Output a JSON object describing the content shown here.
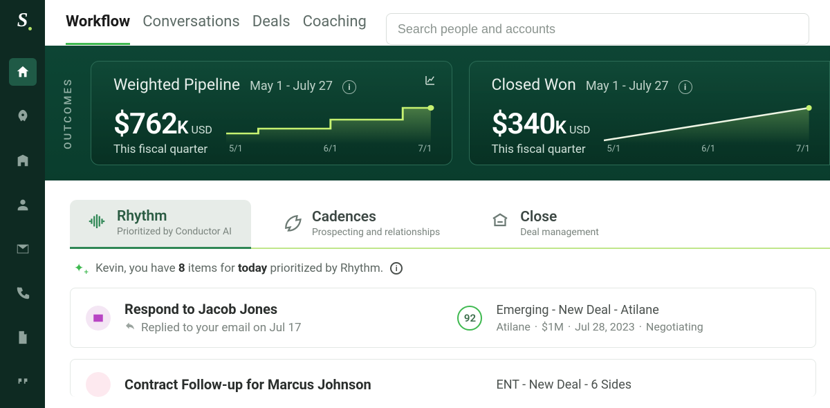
{
  "nav": {
    "items": [
      "Workflow",
      "Conversations",
      "Deals",
      "Coaching"
    ],
    "active": 0
  },
  "search": {
    "placeholder": "Search people and accounts"
  },
  "outcomes_label": "OUTCOMES",
  "cards": [
    {
      "title": "Weighted Pipeline",
      "date_range": "May 1 - July 27",
      "value": "$762",
      "unit": "K",
      "currency": "USD",
      "sub": "This fiscal quarter",
      "ticks": [
        "5/1",
        "6/1",
        "7/1"
      ]
    },
    {
      "title": "Closed Won",
      "date_range": "May 1 - July 27",
      "value": "$340",
      "unit": "K",
      "currency": "USD",
      "sub": "This fiscal quarter",
      "ticks": [
        "5/1",
        "6/1",
        "7/1"
      ]
    }
  ],
  "tabs": [
    {
      "title": "Rhythm",
      "sub": "Prioritized by Conductor AI"
    },
    {
      "title": "Cadences",
      "sub": "Prospecting and relationships"
    },
    {
      "title": "Close",
      "sub": "Deal management"
    }
  ],
  "summary": {
    "prefix": "Kevin, you have ",
    "count": "8",
    "mid": " items for ",
    "bold2": "today",
    "suffix": " prioritized by Rhythm."
  },
  "tasks": [
    {
      "title": "Respond to Jacob Jones",
      "meta": "Replied to your email on Jul 17",
      "score": "92",
      "deal_name": "Emerging - New Deal - Atilane",
      "deal_company": "Atilane",
      "deal_amount": "$1M",
      "deal_date": "Jul 28, 2023",
      "deal_stage": "Negotiating"
    },
    {
      "title": "Contract Follow-up for Marcus Johnson",
      "deal_name": "ENT - New Deal - 6 Sides"
    }
  ],
  "chart_data": [
    {
      "type": "line",
      "title": "Weighted Pipeline",
      "xlabel": "",
      "ylabel": "",
      "x_ticks": [
        "5/1",
        "6/1",
        "7/1"
      ],
      "series": [
        {
          "name": "Weighted Pipeline (USD K)",
          "values": [
            520,
            520,
            560,
            560,
            640,
            640,
            762
          ]
        }
      ],
      "ylim": [
        0,
        800
      ]
    },
    {
      "type": "line",
      "title": "Closed Won",
      "xlabel": "",
      "ylabel": "",
      "x_ticks": [
        "5/1",
        "6/1",
        "7/1"
      ],
      "series": [
        {
          "name": "Closed Won (USD K)",
          "values": [
            120,
            340
          ]
        }
      ],
      "ylim": [
        0,
        400
      ]
    }
  ]
}
